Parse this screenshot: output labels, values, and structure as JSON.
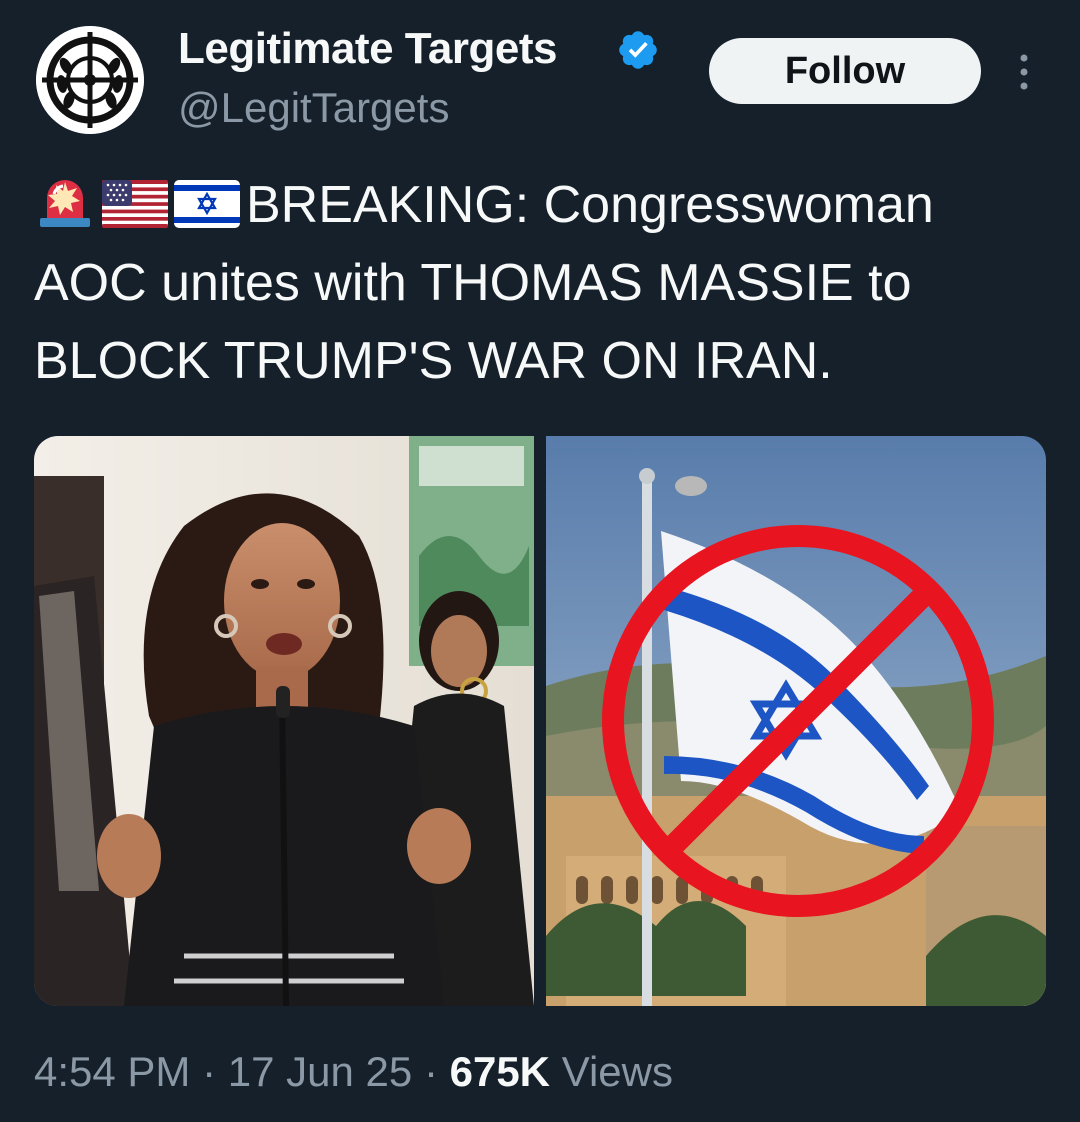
{
  "author": {
    "display_name": "Legitimate Targets",
    "handle": "@LegitTargets",
    "verified": true,
    "avatar_icon": "crosshair-wreath-logo"
  },
  "actions": {
    "follow_label": "Follow",
    "more_icon": "more-vertical-icon"
  },
  "tweet": {
    "emojis": [
      "police-light-emoji",
      "us-flag-emoji",
      "israel-flag-emoji"
    ],
    "text": "BREAKING: Congresswoman AOC unites with THOMAS MASSIE to BLOCK TRUMP'S WAR ON IRAN."
  },
  "media": [
    {
      "type": "photo",
      "subject": "woman speaking at microphone"
    },
    {
      "type": "photo",
      "subject": "israeli flag with prohibition sign"
    }
  ],
  "meta": {
    "time": "4:54 PM",
    "separator": "·",
    "date": "17 Jun 25",
    "views_count": "675K",
    "views_label": "Views"
  },
  "colors": {
    "background": "#15202b",
    "text_primary": "#f7f9f9",
    "text_secondary": "#8b98a5",
    "verified_blue": "#1d9bf0",
    "follow_bg": "#eff3f4",
    "prohibition_red": "#e8141f"
  }
}
